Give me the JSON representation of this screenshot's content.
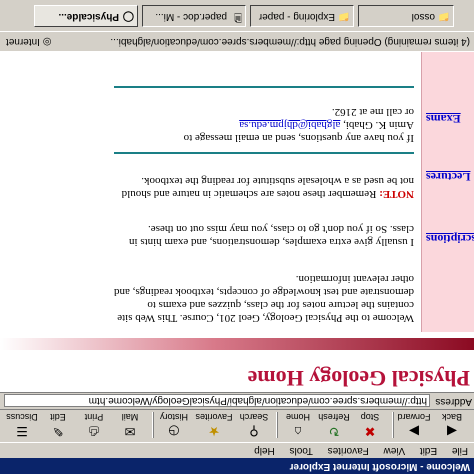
{
  "window": {
    "title": "Welcome - Microsoft Internet Explorer"
  },
  "menu": [
    "File",
    "Edit",
    "View",
    "Favorites",
    "Tools",
    "Help"
  ],
  "toolbar": {
    "buttons": [
      {
        "label": "Back",
        "icon": "back-arrow-icon"
      },
      {
        "label": "Forward",
        "icon": "forward-arrow-icon"
      },
      {
        "label": "Stop",
        "icon": "stop-icon"
      },
      {
        "label": "Refresh",
        "icon": "refresh-icon"
      },
      {
        "label": "Home",
        "icon": "home-icon"
      },
      {
        "label": "Search",
        "icon": "search-icon"
      },
      {
        "label": "Favorites",
        "icon": "favorites-icon"
      },
      {
        "label": "History",
        "icon": "history-icon"
      },
      {
        "label": "Mail",
        "icon": "mail-icon"
      },
      {
        "label": "Print",
        "icon": "print-icon"
      },
      {
        "label": "Edit",
        "icon": "edit-icon"
      },
      {
        "label": "Discuss",
        "icon": "discuss-icon"
      }
    ]
  },
  "address": {
    "label": "Address",
    "url": "http://members.spree.com/education/alghabi/PhysicalGeology/Welcome.htm"
  },
  "page": {
    "banner_title": "Physical Geology Home",
    "sidebar_links": [
      "Descriptions",
      "Lectures",
      "Exams"
    ],
    "welcome_paragraph": "Welcome to the Physical Geology, Geol 201, Course. This Web site contains the lecture notes for the class, quizzes and exams to demonstrate and test knowledge of concepts, textbook readings, and other relevant information.",
    "examples_paragraph": "I usually give extra examples, demonstrations, and exam hints in class. So if you don't go to class, you may miss out on these.",
    "note_label": "NOTE:",
    "note_text": "Remember these notes are schematic in nature and should not be used as a wholesale substitute for reading the textbook.",
    "contact_intro": "If you have any questions, send an email message to",
    "contact_name": "Amin K. Ghabi",
    "contact_email": "alghabi@dhjpm.edu.sa",
    "contact_phone": "or call me at 2162."
  },
  "status": {
    "text": "(4 items remaining) Opening page http://members.spree.com/education/alghabi...",
    "zone": "Internet"
  },
  "taskbar": {
    "tasks": [
      {
        "label": "Physicalde...",
        "active": true
      },
      {
        "label": "paper.doc - Mi...",
        "active": false
      },
      {
        "label": "Exploring - paper",
        "active": false
      },
      {
        "label": "ossol",
        "active": false
      }
    ]
  },
  "colors": {
    "title_bar": "#0a246a",
    "banner_title": "#b5123a",
    "sidebar_bg": "#fbd7dc",
    "rule": "#1a7f86",
    "link": "#0000cc",
    "note": "#cc0000"
  }
}
